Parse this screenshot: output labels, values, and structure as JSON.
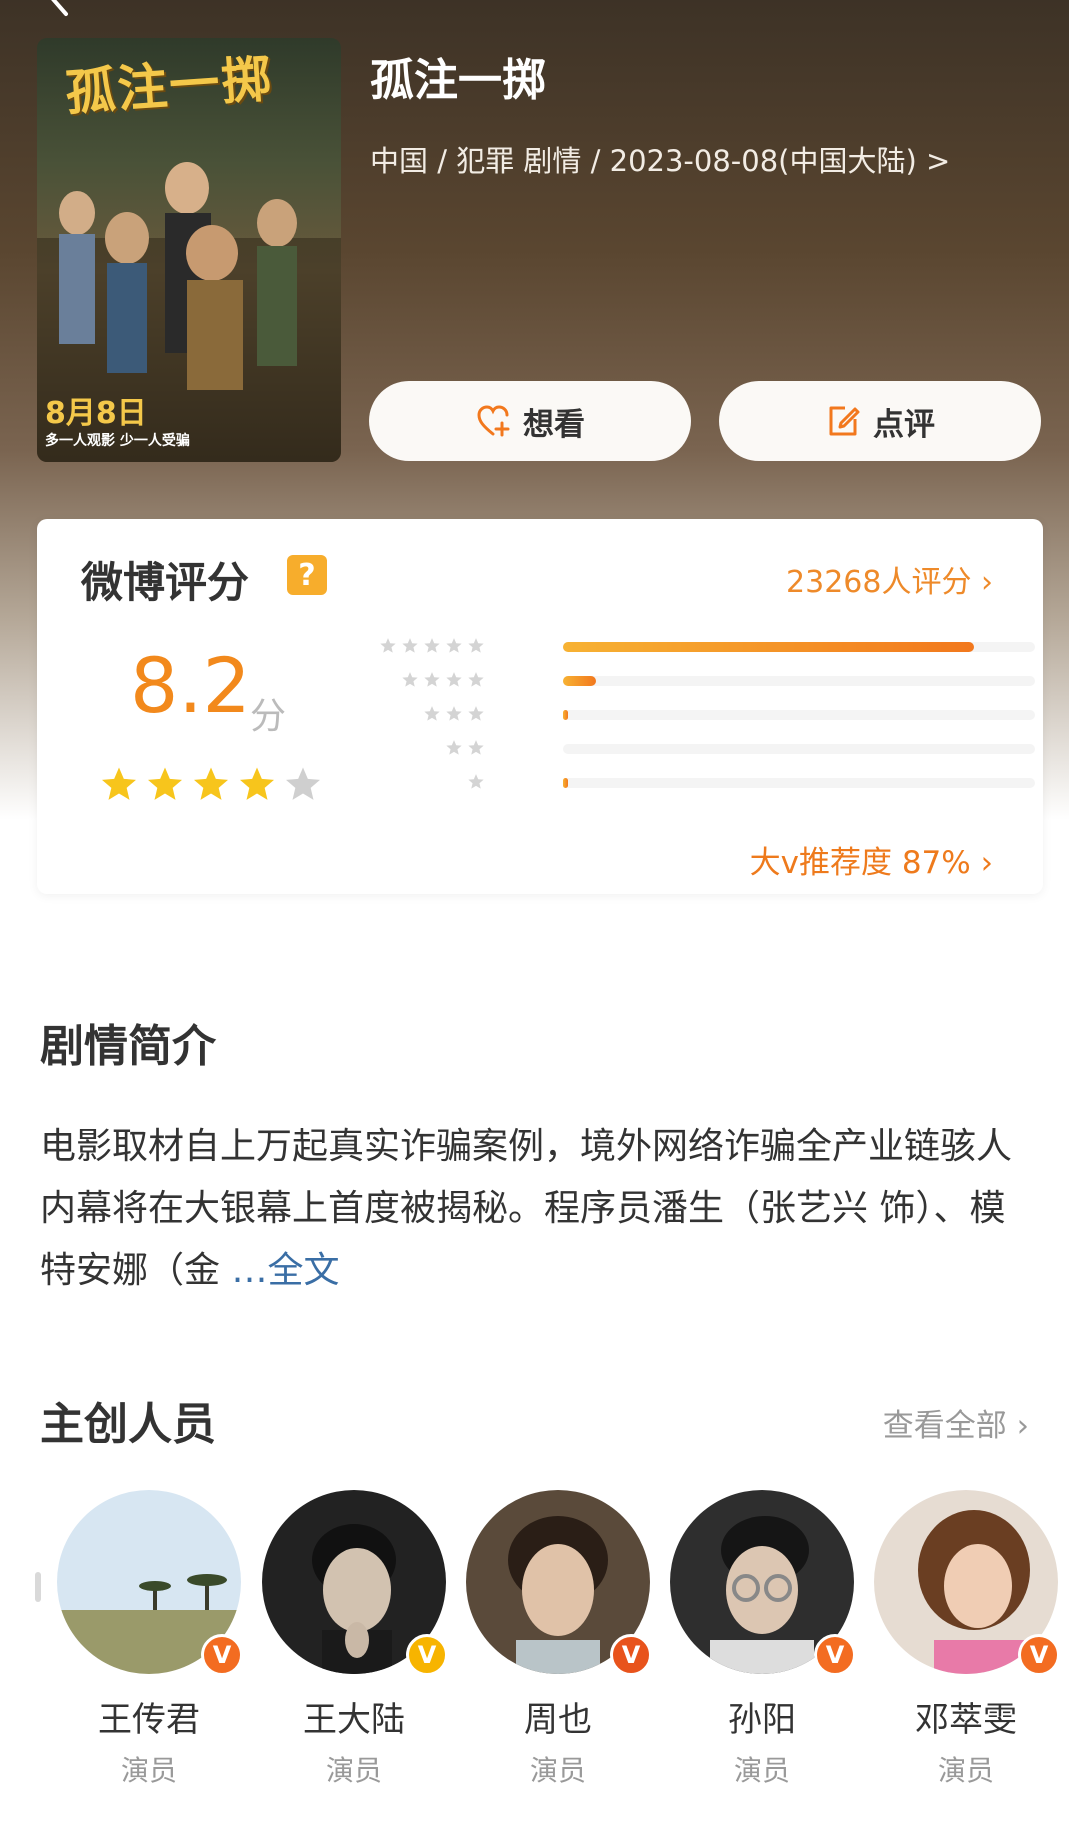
{
  "movie": {
    "title": "孤注一掷",
    "meta": "中国 / 犯罪 剧情 / 2023-08-08(中国大陆) >",
    "poster": {
      "title_art": "孤注一掷",
      "date_text": "8月8日",
      "tagline": "多一人观影 少一人受骗"
    }
  },
  "actions": {
    "want_label": "想看",
    "review_label": "点评"
  },
  "rating": {
    "label": "微博评分",
    "help_icon": "?",
    "count_text": "23268人评分",
    "score": "8.2",
    "score_unit": "分",
    "stars_filled": 4,
    "stars_total": 5,
    "distribution": [
      {
        "stars": 5,
        "fraction": 0.87
      },
      {
        "stars": 4,
        "fraction": 0.07
      },
      {
        "stars": 3,
        "fraction": 0.01
      },
      {
        "stars": 2,
        "fraction": 0.0
      },
      {
        "stars": 1,
        "fraction": 0.01
      }
    ],
    "recommend_text": "大v推荐度 87%"
  },
  "synopsis": {
    "title": "剧情简介",
    "text": "电影取材自上万起真实诈骗案例，境外网络诈骗全产业链骇人内幕将在大银幕上首度被揭秘。程序员潘生（张艺兴 饰）、模特安娜（金",
    "ellipsis": " …",
    "more_label": "全文"
  },
  "crew": {
    "title": "主创人员",
    "view_all": "查看全部",
    "members": [
      {
        "name": "王传君",
        "role": "演员",
        "badge_color": "#f36c21"
      },
      {
        "name": "王大陆",
        "role": "演员",
        "badge_color": "#f7b400"
      },
      {
        "name": "周也",
        "role": "演员",
        "badge_color": "#e8531c"
      },
      {
        "name": "孙阳",
        "role": "演员",
        "badge_color": "#f36c21"
      },
      {
        "name": "邓萃雯",
        "role": "演员",
        "badge_color": "#f36c21"
      }
    ]
  },
  "colors": {
    "accent_orange": "#f2891c",
    "star_gold": "#f7c51c",
    "link_blue": "#3a6ea5"
  },
  "icons": {
    "back": "chevron-left-icon",
    "want": "heart-plus-icon",
    "review": "edit-icon",
    "help": "question-icon",
    "star": "star-icon",
    "verified": "v-badge-icon"
  }
}
